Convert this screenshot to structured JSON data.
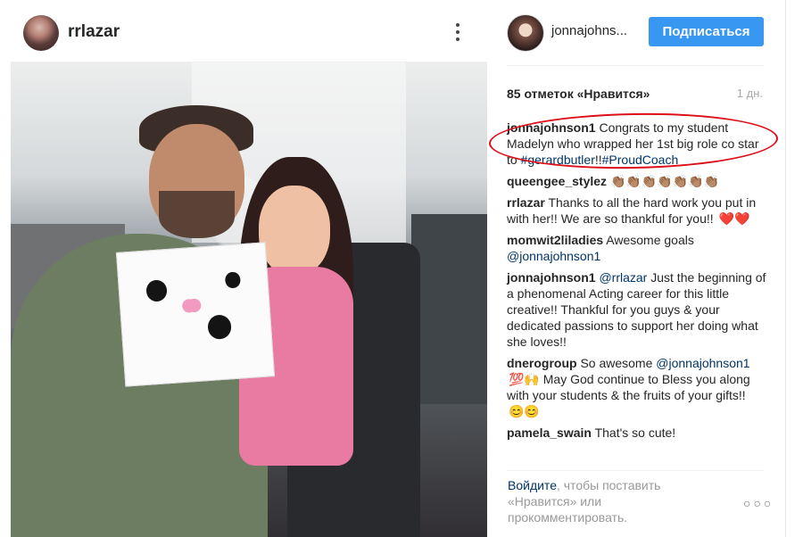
{
  "post_author": {
    "username": "rrlazar"
  },
  "commenter_header": {
    "username": "jonnajohns...",
    "follow_label": "Подписаться"
  },
  "post": {
    "likes": "85 отметок «Нравится»",
    "time": "1 дн."
  },
  "comments": [
    {
      "user": "jonnajohnson1",
      "text_parts": [
        "Congrats to my student Madelyn who wrapped her 1st big role co star to ",
        "#gerardbutler",
        "!!",
        "#ProudCoach"
      ]
    },
    {
      "user": "queengee_stylez",
      "text": "👏🏽👏🏽👏🏽👏🏽👏🏽👏🏽👏🏽"
    },
    {
      "user": "rrlazar",
      "text": "Thanks to all the hard work you put in with her!! We are so thankful for you!!",
      "emoji": "❤️❤️"
    },
    {
      "user": "momwit2liladies",
      "text": "Awesome goals",
      "mention": "@jonnajohnson1"
    },
    {
      "user": "jonnajohnson1",
      "mention": "@rrlazar",
      "text": "Just the beginning of a phenomenal Acting career for this little creative!! Thankful for you guys & your dedicated passions to support her doing what she loves!!"
    },
    {
      "user": "dnerogroup",
      "prefix": "So awesome",
      "mention": "@jonnajohnson1",
      "emoji_prefix": "💯🙌",
      "text": "May God continue to Bless you along with your students & the fruits of your gifts!!",
      "emoji_suffix": "😊😊"
    },
    {
      "user": "pamela_swain",
      "text": "That's so cute!"
    }
  ],
  "footer": {
    "login_link": "Войдите",
    "login_text": ", чтобы поставить «Нравится» или прокомментировать."
  }
}
